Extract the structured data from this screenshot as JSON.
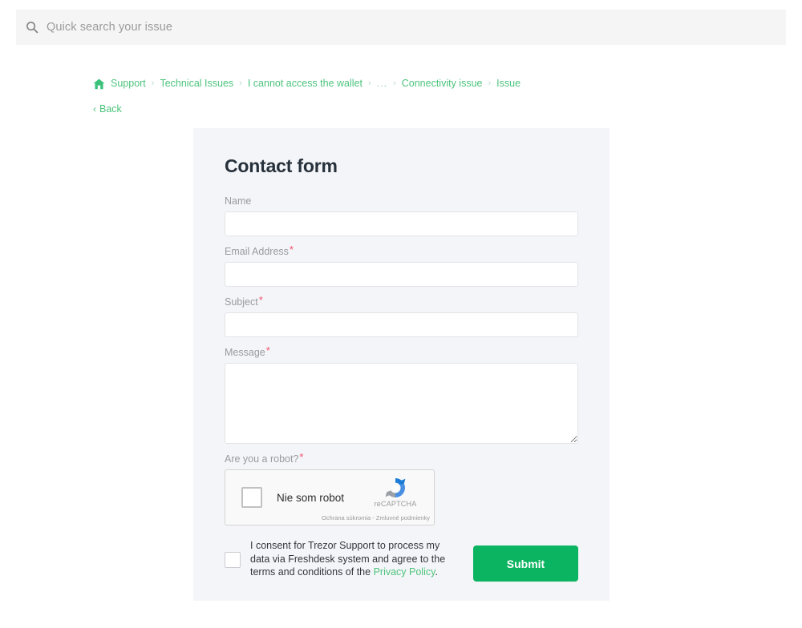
{
  "search": {
    "placeholder": "Quick search your issue",
    "icon": "search-icon"
  },
  "breadcrumb": {
    "home_icon": "home-icon",
    "separator": "›",
    "items": [
      {
        "label": "Support"
      },
      {
        "label": "Technical Issues"
      },
      {
        "label": "I cannot access the wallet"
      },
      {
        "label": "..."
      },
      {
        "label": "Connectivity issue"
      },
      {
        "label": "Issue"
      }
    ]
  },
  "back": {
    "label": "Back",
    "chevron": "‹"
  },
  "form": {
    "title": "Contact form",
    "fields": [
      {
        "label": "Name",
        "required": "",
        "value": "",
        "placeholder": ""
      },
      {
        "label": "Email Address",
        "required": "*",
        "value": "",
        "placeholder": ""
      },
      {
        "label": "Subject",
        "required": "*",
        "value": "",
        "placeholder": ""
      },
      {
        "label": "Message",
        "required": "*",
        "value": "",
        "placeholder": ""
      }
    ],
    "captcha": {
      "label": "Are you a robot?",
      "required": "*",
      "checkbox_label": "Nie som robot",
      "brand": "reCAPTCHA",
      "terms": "Ochrana súkromia - Zmluvné podmienky",
      "logo_icon": "recaptcha-logo-icon"
    },
    "consent": {
      "text_before": "I consent for Trezor Support to process my data via Freshdesk system and agree to the terms and conditions of the ",
      "link": "Privacy Policy",
      "text_after": "."
    },
    "submit_label": "Submit"
  },
  "colors": {
    "accent_green": "#4cc47c",
    "submit_green": "#0bb460",
    "required_red": "#f2536d",
    "panel_bg": "#f4f5f8",
    "searchbar_bg": "#f5f5f5"
  }
}
